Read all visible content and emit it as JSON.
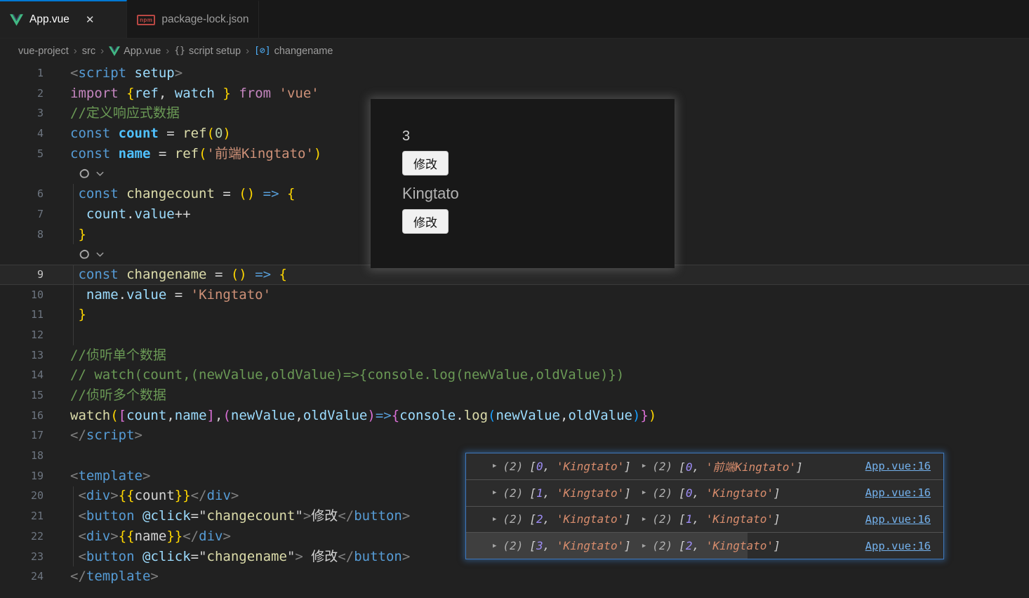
{
  "tabs": {
    "active": {
      "label": "App.vue",
      "close": "✕"
    },
    "inactive": {
      "label": "package-lock.json",
      "icon_label": "npm"
    }
  },
  "breadcrumb": {
    "separator": "›",
    "items": [
      "vue-project",
      "src",
      "App.vue",
      "script setup",
      "changename"
    ],
    "braces_icon": "{}",
    "symbol_icon": "[⊘]"
  },
  "editor": {
    "current_line": 9,
    "rows": [
      {
        "n": "1",
        "t": [
          [
            "<",
            "pun"
          ],
          [
            "script",
            "tag"
          ],
          [
            " setup",
            "attr"
          ],
          [
            ">",
            "pun"
          ]
        ]
      },
      {
        "n": "2",
        "t": [
          [
            "import",
            "ctrl"
          ],
          [
            " ",
            "op"
          ],
          [
            "{",
            "b1"
          ],
          [
            "ref",
            "var"
          ],
          [
            ",",
            "op"
          ],
          [
            " watch ",
            "var"
          ],
          [
            "}",
            "b1"
          ],
          [
            " ",
            "op"
          ],
          [
            "from",
            "ctrl"
          ],
          [
            " ",
            "op"
          ],
          [
            "'vue'",
            "str"
          ]
        ]
      },
      {
        "n": "3",
        "t": [
          [
            "//定义响应式数据",
            "cmt"
          ]
        ]
      },
      {
        "n": "4",
        "t": [
          [
            "const",
            "kw"
          ],
          [
            " ",
            "op"
          ],
          [
            "count",
            "cvar"
          ],
          [
            " = ",
            "op"
          ],
          [
            "ref",
            "fn"
          ],
          [
            "(",
            "b1"
          ],
          [
            "0",
            "num"
          ],
          [
            ")",
            "b1"
          ]
        ]
      },
      {
        "n": "5",
        "t": [
          [
            "const",
            "kw"
          ],
          [
            " ",
            "op"
          ],
          [
            "name",
            "cvar"
          ],
          [
            " = ",
            "op"
          ],
          [
            "ref",
            "fn"
          ],
          [
            "(",
            "b1"
          ],
          [
            "'前端Kingtato'",
            "str"
          ],
          [
            ")",
            "b1"
          ]
        ]
      },
      {
        "lens": true
      },
      {
        "n": "6",
        "t": [
          [
            " ",
            "op"
          ],
          [
            "const",
            "kw"
          ],
          [
            " ",
            "op"
          ],
          [
            "changecount",
            "fn"
          ],
          [
            " = ",
            "op"
          ],
          [
            "(",
            "b1"
          ],
          [
            ")",
            "b1"
          ],
          [
            " ",
            "op"
          ],
          [
            "=>",
            "kw"
          ],
          [
            " ",
            "op"
          ],
          [
            "{",
            "b1"
          ]
        ]
      },
      {
        "n": "7",
        "t": [
          [
            "  ",
            "op"
          ],
          [
            "count",
            "var"
          ],
          [
            ".",
            "op"
          ],
          [
            "value",
            "var"
          ],
          [
            "++",
            "op"
          ]
        ]
      },
      {
        "n": "8",
        "t": [
          [
            " ",
            "op"
          ],
          [
            "}",
            "b1"
          ]
        ]
      },
      {
        "lens": true
      },
      {
        "n": "9",
        "t": [
          [
            " ",
            "op"
          ],
          [
            "const",
            "kw"
          ],
          [
            " ",
            "op"
          ],
          [
            "changename",
            "fn"
          ],
          [
            " = ",
            "op"
          ],
          [
            "(",
            "b1"
          ],
          [
            ")",
            "b1"
          ],
          [
            " ",
            "op"
          ],
          [
            "=>",
            "kw"
          ],
          [
            " ",
            "op"
          ],
          [
            "{",
            "b1"
          ]
        ]
      },
      {
        "n": "10",
        "t": [
          [
            "  ",
            "op"
          ],
          [
            "name",
            "var"
          ],
          [
            ".",
            "op"
          ],
          [
            "value",
            "var"
          ],
          [
            " = ",
            "op"
          ],
          [
            "'Kingtato'",
            "str"
          ]
        ]
      },
      {
        "n": "11",
        "t": [
          [
            " ",
            "op"
          ],
          [
            "}",
            "b1"
          ]
        ]
      },
      {
        "n": "12",
        "t": []
      },
      {
        "n": "13",
        "t": [
          [
            "//侦听单个数据",
            "cmt"
          ]
        ]
      },
      {
        "n": "14",
        "t": [
          [
            "// watch(count,(newValue,oldValue)=>{console.log(newValue,oldValue)})",
            "cmt"
          ]
        ]
      },
      {
        "n": "15",
        "t": [
          [
            "//侦听多个数据",
            "cmt"
          ]
        ]
      },
      {
        "n": "16",
        "t": [
          [
            "watch",
            "fn"
          ],
          [
            "(",
            "b1"
          ],
          [
            "[",
            "b2"
          ],
          [
            "count",
            "var"
          ],
          [
            ",",
            "op"
          ],
          [
            "name",
            "var"
          ],
          [
            "]",
            "b2"
          ],
          [
            ",",
            "op"
          ],
          [
            "(",
            "b2"
          ],
          [
            "newValue",
            "var"
          ],
          [
            ",",
            "op"
          ],
          [
            "oldValue",
            "var"
          ],
          [
            ")",
            "b2"
          ],
          [
            "=>",
            "kw"
          ],
          [
            "{",
            "b2"
          ],
          [
            "console",
            "var"
          ],
          [
            ".",
            "op"
          ],
          [
            "log",
            "fn"
          ],
          [
            "(",
            "b3"
          ],
          [
            "newValue",
            "var"
          ],
          [
            ",",
            "op"
          ],
          [
            "oldValue",
            "var"
          ],
          [
            ")",
            "b3"
          ],
          [
            "}",
            "b2"
          ],
          [
            ")",
            "b1"
          ]
        ]
      },
      {
        "n": "17",
        "t": [
          [
            "</",
            "pun"
          ],
          [
            "script",
            "tag"
          ],
          [
            ">",
            "pun"
          ]
        ]
      },
      {
        "n": "18",
        "t": []
      },
      {
        "n": "19",
        "t": [
          [
            "<",
            "pun"
          ],
          [
            "template",
            "tag"
          ],
          [
            ">",
            "pun"
          ]
        ]
      },
      {
        "n": "20",
        "t": [
          [
            " ",
            "op"
          ],
          [
            "<",
            "pun"
          ],
          [
            "div",
            "tag"
          ],
          [
            ">",
            "pun"
          ],
          [
            "{{",
            "b1"
          ],
          [
            "count",
            "op"
          ],
          [
            "}}",
            "b1"
          ],
          [
            "</",
            "pun"
          ],
          [
            "div",
            "tag"
          ],
          [
            ">",
            "pun"
          ]
        ]
      },
      {
        "n": "21",
        "t": [
          [
            " ",
            "op"
          ],
          [
            "<",
            "pun"
          ],
          [
            "button",
            "tag"
          ],
          [
            " ",
            "op"
          ],
          [
            "@click",
            "attr"
          ],
          [
            "=",
            "op"
          ],
          [
            "\"",
            "op"
          ],
          [
            "changecount",
            "fn"
          ],
          [
            "\"",
            "op"
          ],
          [
            ">",
            "pun"
          ],
          [
            "修改",
            "op"
          ],
          [
            "</",
            "pun"
          ],
          [
            "button",
            "tag"
          ],
          [
            ">",
            "pun"
          ]
        ]
      },
      {
        "n": "22",
        "t": [
          [
            " ",
            "op"
          ],
          [
            "<",
            "pun"
          ],
          [
            "div",
            "tag"
          ],
          [
            ">",
            "pun"
          ],
          [
            "{{",
            "b1"
          ],
          [
            "name",
            "op"
          ],
          [
            "}}",
            "b1"
          ],
          [
            "</",
            "pun"
          ],
          [
            "div",
            "tag"
          ],
          [
            ">",
            "pun"
          ]
        ]
      },
      {
        "n": "23",
        "t": [
          [
            " ",
            "op"
          ],
          [
            "<",
            "pun"
          ],
          [
            "button",
            "tag"
          ],
          [
            " ",
            "op"
          ],
          [
            "@click",
            "attr"
          ],
          [
            "=",
            "op"
          ],
          [
            "\"",
            "op"
          ],
          [
            "changename",
            "fn"
          ],
          [
            "\"",
            "op"
          ],
          [
            ">",
            "pun"
          ],
          [
            " 修改",
            "op"
          ],
          [
            "</",
            "pun"
          ],
          [
            "button",
            "tag"
          ],
          [
            ">",
            "pun"
          ]
        ]
      },
      {
        "n": "24",
        "t": [
          [
            "</",
            "pun"
          ],
          [
            "template",
            "tag"
          ],
          [
            ">",
            "pun"
          ]
        ]
      }
    ]
  },
  "overlay": {
    "count_value": "3",
    "change_count_button": "修改",
    "name_value": "Kingtato",
    "change_name_button": "修改"
  },
  "console": {
    "rows": [
      {
        "badge": "(2)",
        "first": {
          "number": "0",
          "string": "'Kingtato'"
        },
        "second": {
          "number": "0",
          "string": "'前端Kingtato'"
        },
        "link": "App.vue:16",
        "selected": false
      },
      {
        "badge": "(2)",
        "first": {
          "number": "1",
          "string": "'Kingtato'"
        },
        "second": {
          "number": "0",
          "string": "'Kingtato'"
        },
        "link": "App.vue:16",
        "selected": false
      },
      {
        "badge": "(2)",
        "first": {
          "number": "2",
          "string": "'Kingtato'"
        },
        "second": {
          "number": "1",
          "string": "'Kingtato'"
        },
        "link": "App.vue:16",
        "selected": false
      },
      {
        "badge": "(2)",
        "first": {
          "number": "3",
          "string": "'Kingtato'"
        },
        "second": {
          "number": "2",
          "string": "'Kingtato'"
        },
        "link": "App.vue:16",
        "selected": true
      }
    ]
  },
  "colors": {
    "accent_blue": "#0078d4",
    "console_border": "#3f79bd",
    "vue_green": "#41B883",
    "vue_dark": "#35495E"
  }
}
